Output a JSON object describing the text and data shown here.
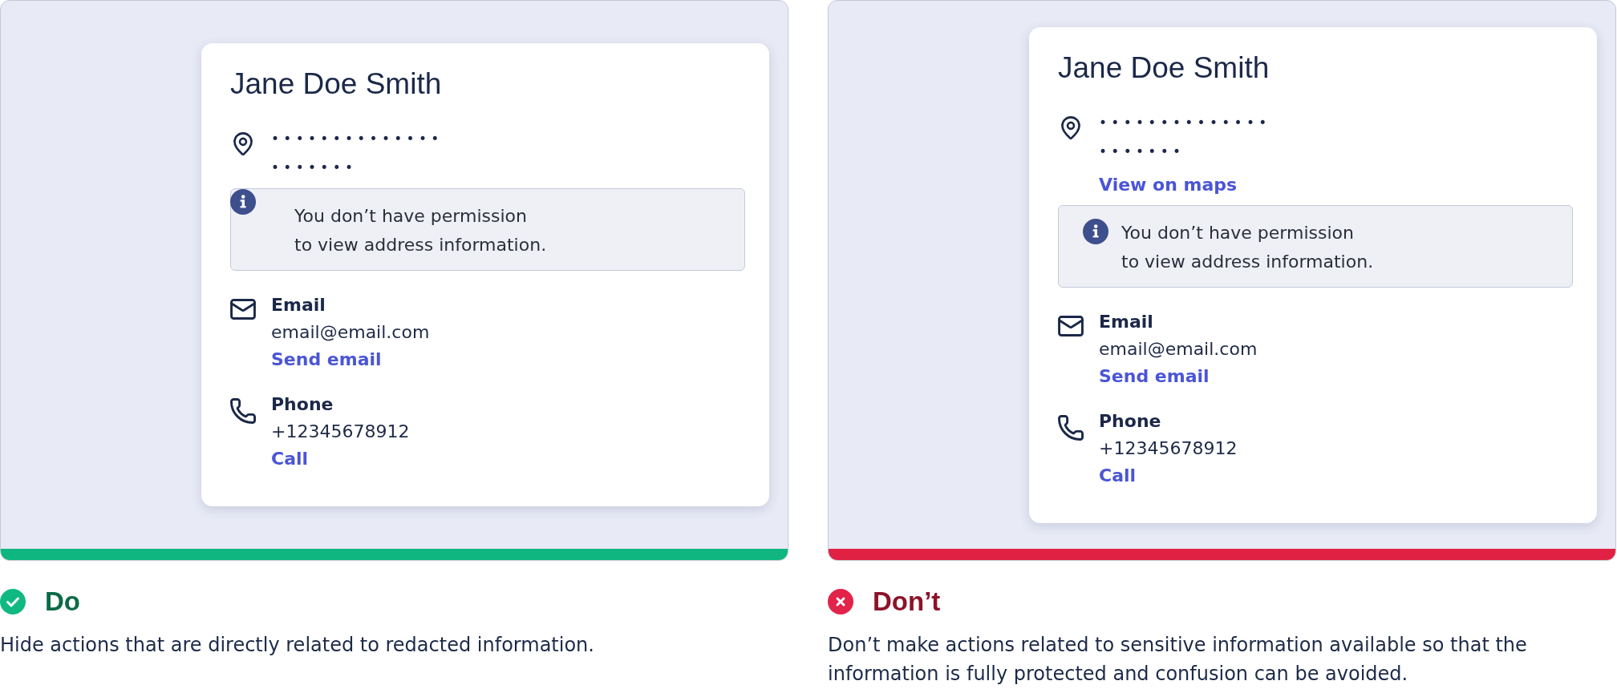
{
  "examples": [
    {
      "kind": "do",
      "card": {
        "name": "Jane Doe Smith",
        "address_lines": [
          "••••••••••••••",
          "•••••••"
        ],
        "notice": {
          "kind": "corner",
          "lines": [
            "You don’t have permission",
            "to view address information."
          ]
        },
        "contacts": [
          {
            "kind": "email",
            "label": "Email",
            "value": "email@email.com",
            "action": "Send email"
          },
          {
            "kind": "phone",
            "label": "Phone",
            "value": "+12345678912",
            "action": "Call"
          }
        ]
      },
      "verdict": "Do",
      "description_lines": [
        "Hide actions that are directly related to redacted information."
      ]
    },
    {
      "kind": "dont",
      "card": {
        "name": "Jane Doe Smith",
        "address_lines": [
          "••••••••••••••",
          "•••••••"
        ],
        "address_action": "View on maps",
        "notice": {
          "kind": "inline",
          "lines": [
            "You don’t have permission",
            "to view address information."
          ]
        },
        "contacts": [
          {
            "kind": "email",
            "label": "Email",
            "value": "email@email.com",
            "action": "Send email"
          },
          {
            "kind": "phone",
            "label": "Phone",
            "value": "+12345678912",
            "action": "Call"
          }
        ]
      },
      "verdict": "Don’t",
      "description_lines": [
        "Don’t make actions related to sensitive information available so that the",
        "information is fully protected and confusion can be avoided."
      ]
    }
  ]
}
